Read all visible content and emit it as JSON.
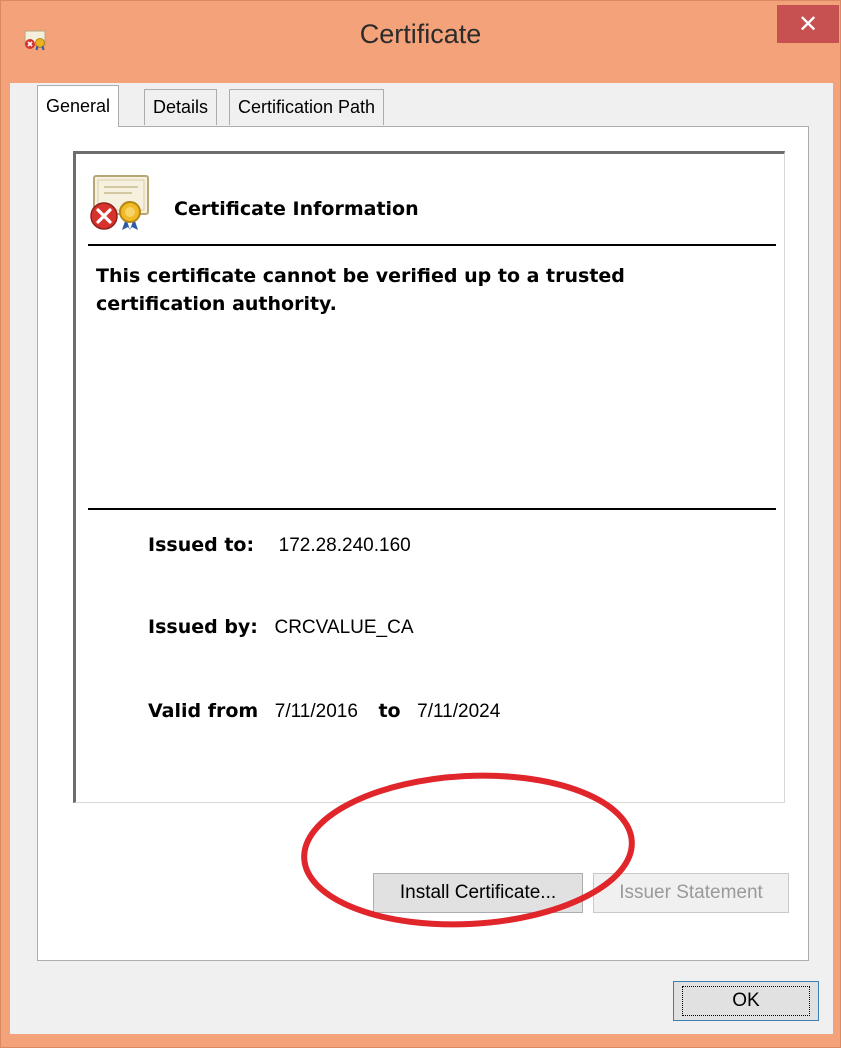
{
  "window": {
    "title": "Certificate",
    "close_glyph": "✕",
    "accent_color": "#f3a27a",
    "close_color": "#c75050"
  },
  "tabs": [
    {
      "label": "General",
      "active": true
    },
    {
      "label": "Details",
      "active": false
    },
    {
      "label": "Certification Path",
      "active": false
    }
  ],
  "info": {
    "icon": "certificate-error-icon",
    "heading": "Certificate Information",
    "warning": "This certificate cannot be verified up to a trusted certification authority.",
    "issued_to_label": "Issued to:",
    "issued_to_value": "172.28.240.160",
    "issued_by_label": "Issued by:",
    "issued_by_value": "CRCVALUE_CA",
    "valid_from_label": "Valid from",
    "valid_from_value": "7/11/2016",
    "valid_to_label": "to",
    "valid_to_value": "7/11/2024"
  },
  "buttons": {
    "install": "Install Certificate...",
    "issuer": "Issuer Statement",
    "ok": "OK"
  },
  "annotation": {
    "shape": "red-ellipse",
    "color": "#e0252b"
  }
}
